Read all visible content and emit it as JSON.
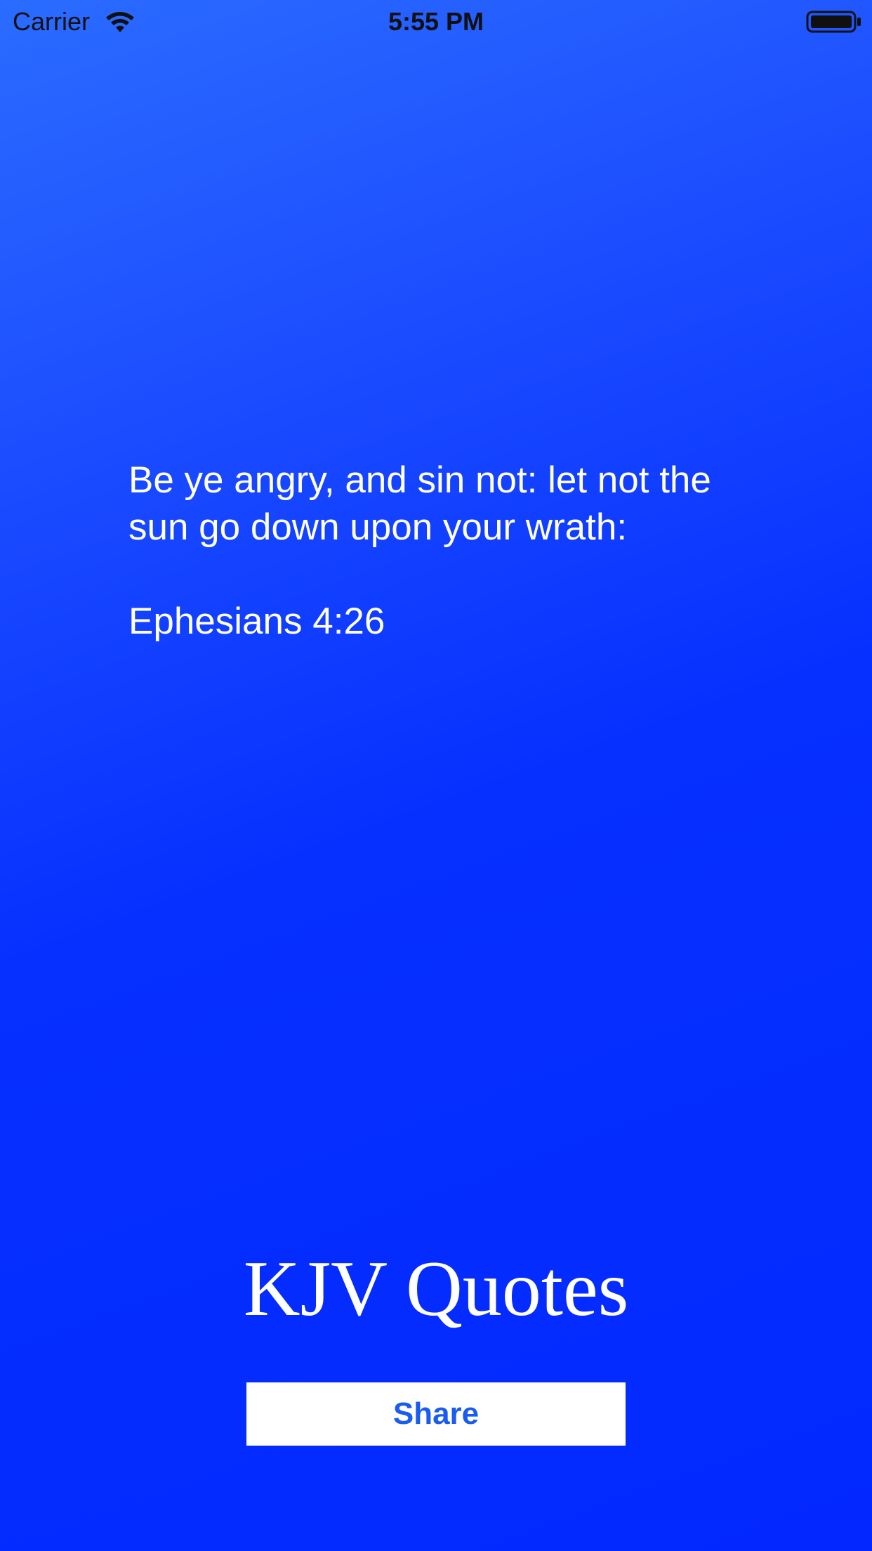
{
  "status_bar": {
    "carrier": "Carrier",
    "time": "5:55 PM",
    "wifi_icon": "wifi-icon",
    "battery_icon": "battery-icon"
  },
  "quote": {
    "text": "Be ye angry, and sin not: let not the sun go down upon your wrath:",
    "reference": "Ephesians 4:26"
  },
  "app": {
    "title": "KJV Quotes",
    "share_label": "Share"
  },
  "colors": {
    "background_top": "#2b6cff",
    "background_bottom": "#0228ff",
    "text": "#ffffff",
    "button_background": "#ffffff",
    "button_text": "#1a5cf0"
  }
}
